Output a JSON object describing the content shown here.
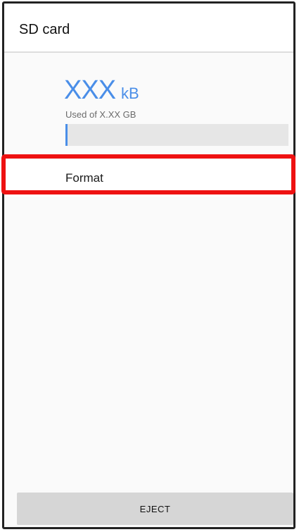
{
  "appbar": {
    "title": "SD card"
  },
  "storage": {
    "used_value": "XXX",
    "used_unit": "kB",
    "caption": "Used of X.XX GB",
    "progress_fraction": 0.008
  },
  "actions": {
    "format_label": "Format",
    "eject_label": "EJECT"
  },
  "colors": {
    "accent": "#4a8ee8",
    "highlight": "#ee1111",
    "button_background": "#d6d6d6"
  }
}
